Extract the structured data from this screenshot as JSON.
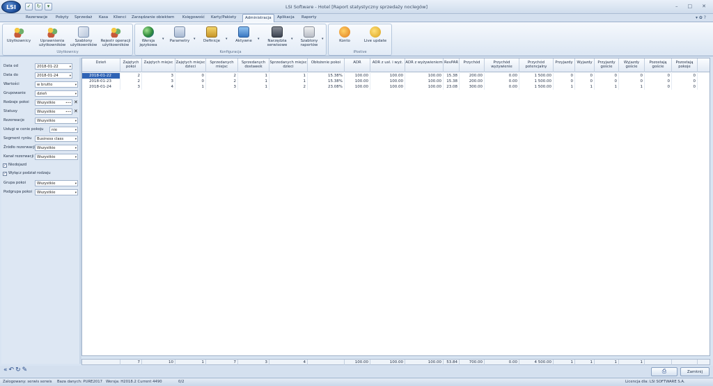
{
  "app": {
    "logo": "LSI",
    "title": "LSI Software -  Hotel [Raport statystyczny sprzedaży noclegów]"
  },
  "menu": {
    "tabs": [
      "Rezerwacje",
      "Pobyty",
      "Sprzedaż",
      "Kasa",
      "Klienci",
      "Zarządzanie obiektem",
      "Księgowość",
      "Karty/Pakiety",
      "Administracja",
      "Aplikacja",
      "Raporty"
    ],
    "active": "Administracja"
  },
  "ribbon": {
    "groups": [
      {
        "label": "Użytkownicy",
        "buttons": [
          "Użytkownicy",
          "Uprawnienia użytkowników",
          "Szablony użytkowników",
          "Rejestr operacji użytkowników"
        ]
      },
      {
        "label": "Konfiguracja",
        "buttons": [
          "Wersja językowa",
          "Parametry",
          "Definicje",
          "Aktywne",
          "Narzędzia serwisowe",
          "Szablony raportów"
        ]
      },
      {
        "label": "iPostive",
        "buttons": [
          "Konto",
          "Live update"
        ]
      }
    ]
  },
  "filters": {
    "data_od": {
      "label": "Data od",
      "value": "2018-01-22"
    },
    "data_do": {
      "label": "Data do",
      "value": "2018-01-24"
    },
    "wartosci": {
      "label": "Wartości",
      "value": "w brutto"
    },
    "grupowanie": {
      "label": "Grupowanie",
      "value": "dzień"
    },
    "rodzaje_pokoi": {
      "label": "Rodzaje pokoi",
      "value": "Wszystkie"
    },
    "statusy": {
      "label": "Statusy",
      "value": "Wszystkie"
    },
    "rezerwacje": {
      "label": "Rezerwacje",
      "value": "Wszystkie"
    },
    "uslugi": {
      "label": "Usługi w cenie pokoju",
      "value": "nie"
    },
    "segment": {
      "label": "Segment rynku",
      "value": "Business class"
    },
    "zrodlo": {
      "label": "Źródło rezerwacji",
      "value": "Wszystkie"
    },
    "kanal": {
      "label": "Kanał rezerwacji",
      "value": "Wszystkie"
    },
    "niedojazd": {
      "label": "Niedojazd",
      "checked": true
    },
    "wylacz": {
      "label": "Wyłącz podział rodzaju",
      "checked": true
    },
    "grupa": {
      "label": "Grupa pokoi",
      "value": "Wszystkie"
    },
    "podgrupa": {
      "label": "Podgrupa pokoi",
      "value": "Wszystkie"
    }
  },
  "table": {
    "columns": [
      "Dzień",
      "Zajętych pokoi",
      "Zajętych miejsc",
      "Zajętych miejsc dzieci",
      "Sprzedanych miejsc",
      "Sprzedanych dostawek",
      "Sprzedanych miejsc dzieci",
      "Obłożenie pokoi",
      "ADR",
      "ADR z usł. i wyż.",
      "ADR z wyżywieniem",
      "RevPAR",
      "Przychód",
      "Przychód wyżywienie",
      "Przychód potencjalny",
      "Przyjazdy",
      "Wyjazdy",
      "Przyjazdy goście",
      "Wyjazdy goście",
      "Pozostają goście",
      "Pozostają pokoje"
    ],
    "rows": [
      [
        "2018-01-22",
        "2",
        "3",
        "0",
        "2",
        "1",
        "1",
        "15.38%",
        "100.00",
        "100.00",
        "100.00",
        "15.38",
        "200.00",
        "0.00",
        "1 500.00",
        "0",
        "0",
        "0",
        "0",
        "0",
        "0"
      ],
      [
        "2018-01-23",
        "2",
        "3",
        "0",
        "2",
        "1",
        "1",
        "15.38%",
        "100.00",
        "100.00",
        "100.00",
        "15.38",
        "200.00",
        "0.00",
        "1 500.00",
        "0",
        "0",
        "0",
        "0",
        "0",
        "0"
      ],
      [
        "2018-01-24",
        "3",
        "4",
        "1",
        "3",
        "1",
        "2",
        "23.08%",
        "100.00",
        "100.00",
        "100.00",
        "23.08",
        "300.00",
        "0.00",
        "1 500.00",
        "1",
        "1",
        "1",
        "1",
        "0",
        "0"
      ]
    ],
    "totals": [
      "",
      "7",
      "10",
      "1",
      "7",
      "3",
      "4",
      "",
      "100.00",
      "100.00",
      "100.00",
      "53.84",
      "700.00",
      "0.00",
      "4 500.00",
      "1",
      "1",
      "1",
      "1",
      "",
      ""
    ]
  },
  "buttons": {
    "close": "Zamknij"
  },
  "status": {
    "user": "Zalogowany: serwis serwis",
    "db": "Baza danych: PURE2017",
    "version": "Wersja: H2018.2 Current 4490",
    "pages": "0/2",
    "license": "Licencja dla: LSI SOFTWARE S.A."
  }
}
